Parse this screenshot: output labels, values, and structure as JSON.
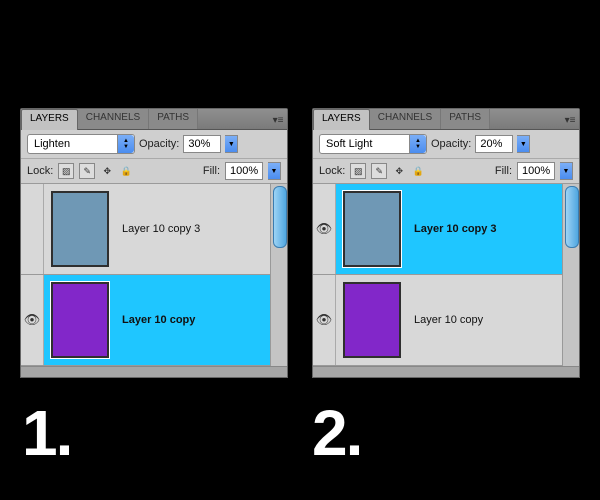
{
  "labels": {
    "num1": "1.",
    "num2": "2."
  },
  "tabs": {
    "layers": "LAYERS",
    "channels": "CHANNELS",
    "paths": "PATHS"
  },
  "common": {
    "opacity_label": "Opacity:",
    "lock_label": "Lock:",
    "fill_label": "Fill:",
    "fill_value": "100%"
  },
  "panel1": {
    "blend_mode": "Lighten",
    "opacity": "30%",
    "layers": [
      {
        "name": "Layer 10 copy 3",
        "thumb": "blue",
        "selected": false,
        "visible": false
      },
      {
        "name": "Layer 10 copy",
        "thumb": "purple",
        "selected": true,
        "visible": true
      }
    ]
  },
  "panel2": {
    "blend_mode": "Soft Light",
    "opacity": "20%",
    "layers": [
      {
        "name": "Layer 10 copy 3",
        "thumb": "blue",
        "selected": true,
        "visible": true
      },
      {
        "name": "Layer 10 copy",
        "thumb": "purple",
        "selected": false,
        "visible": true
      }
    ]
  }
}
